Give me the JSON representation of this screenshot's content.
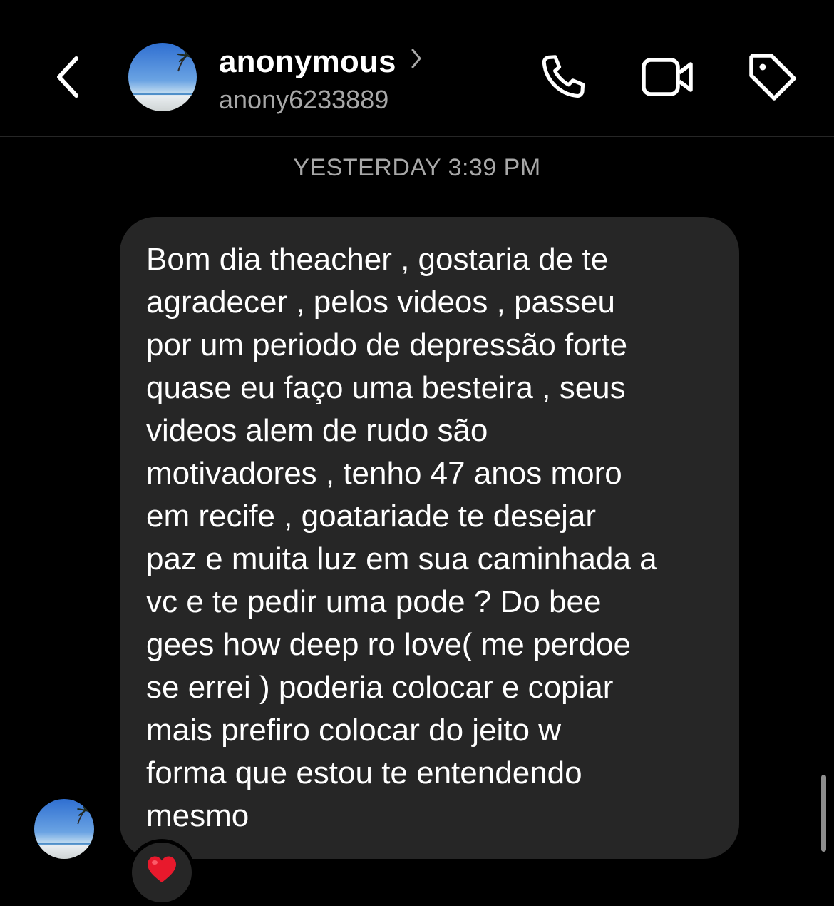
{
  "header": {
    "display_name": "anonymous",
    "username": "anony6233889",
    "icons": {
      "back": "chevron-left-icon",
      "profile_chevron": "chevron-right-icon",
      "call": "phone-icon",
      "video": "video-camera-icon",
      "tag": "tag-icon"
    }
  },
  "thread": {
    "timestamp": "YESTERDAY 3:39 PM",
    "message": {
      "lines": [
        "Bom dia theacher , gostaria de te",
        "agradecer , pelos videos , passeu",
        "por um periodo de depressão forte",
        "quase eu faço uma besteira , seus",
        "videos alem de rudo são",
        "motivadores , tenho 47 anos moro",
        "em recife , goatariade te desejar",
        "paz e muita luz em sua caminhada a",
        "vc e te pedir uma pode ? Do bee",
        "gees how deep ro love( me perdoe",
        "se errei ) poderia colocar e copiar",
        "mais prefiro colocar do jeito w",
        "forma que estou te entendendo",
        "mesmo"
      ]
    },
    "reaction": "❤️"
  },
  "colors": {
    "background": "#000000",
    "bubble": "#262626",
    "secondary_text": "#a8a8a8"
  }
}
